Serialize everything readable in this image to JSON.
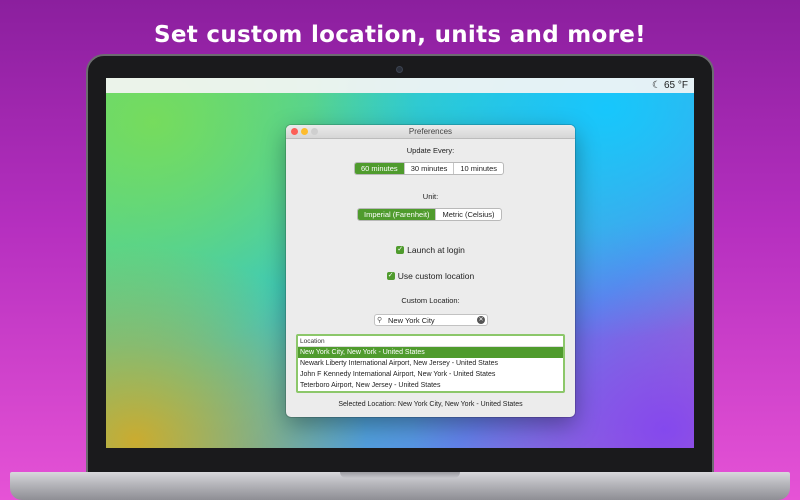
{
  "headline": "Set custom location, units and more!",
  "menubar": {
    "weather_icon": "moon-icon",
    "temperature": "65 °F"
  },
  "window": {
    "title": "Preferences",
    "update_every_label": "Update Every:",
    "update_options": [
      "60 minutes",
      "30 minutes",
      "10 minutes"
    ],
    "update_selected": "60 minutes",
    "unit_label": "Unit:",
    "unit_options": [
      "Imperial (Farenheit)",
      "Metric (Celsius)"
    ],
    "unit_selected": "Imperial (Farenheit)",
    "launch_at_login": {
      "label": "Launch at login",
      "checked": true
    },
    "use_custom_location": {
      "label": "Use custom location",
      "checked": true
    },
    "custom_location_label": "Custom Location:",
    "search": {
      "value": "New York City",
      "icon": "search-icon"
    },
    "results": {
      "header": "Location",
      "rows": [
        "New York City, New York - United States",
        "Newark Liberty International Airport, New Jersey - United States",
        "John F Kennedy International Airport, New York - United States",
        "Teterboro Airport, New Jersey - United States"
      ],
      "selected_index": 0
    },
    "selected_location": "Selected Location: New York City, New York - United States"
  },
  "colors": {
    "accent_green": "#4f9b2d",
    "close": "#fc5f57",
    "minimize": "#fdbc2e"
  }
}
